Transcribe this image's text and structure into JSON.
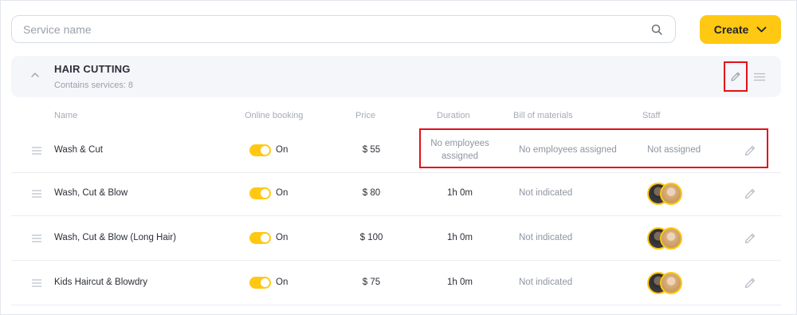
{
  "search": {
    "placeholder": "Service name",
    "value": ""
  },
  "create_button": {
    "label": "Create"
  },
  "category": {
    "title": "HAIR CUTTING",
    "subtitle": "Contains services: 8"
  },
  "columns": {
    "name": "Name",
    "online_booking": "Online booking",
    "price": "Price",
    "duration": "Duration",
    "bill_of_materials": "Bill of materials",
    "staff": "Staff"
  },
  "services": [
    {
      "name": "Wash & Cut",
      "online_label": "On",
      "online": true,
      "price": "$ 55",
      "duration": "No employees\nassigned",
      "bom": "No employees assigned",
      "staff": "Not assigned",
      "has_avatars": false
    },
    {
      "name": "Wash, Cut & Blow",
      "online_label": "On",
      "online": true,
      "price": "$ 80",
      "duration": "1h 0m",
      "bom": "Not indicated",
      "staff": "",
      "has_avatars": true
    },
    {
      "name": "Wash, Cut & Blow (Long Hair)",
      "online_label": "On",
      "online": true,
      "price": "$ 100",
      "duration": "1h 0m",
      "bom": "Not indicated",
      "staff": "",
      "has_avatars": true
    },
    {
      "name": "Kids Haircut & Blowdry",
      "online_label": "On",
      "online": true,
      "price": "$ 75",
      "duration": "1h 0m",
      "bom": "Not indicated",
      "staff": "",
      "has_avatars": true
    }
  ],
  "colors": {
    "accent": "#ffc812",
    "highlight": "#e3101a",
    "category_bg": "#f4f6fa"
  },
  "icons": {
    "search": "search-icon",
    "create": "chevron-down-icon",
    "collapse": "chevron-up-icon",
    "edit": "pencil-icon",
    "menu": "menu-icon",
    "drag": "drag-handle-icon"
  }
}
